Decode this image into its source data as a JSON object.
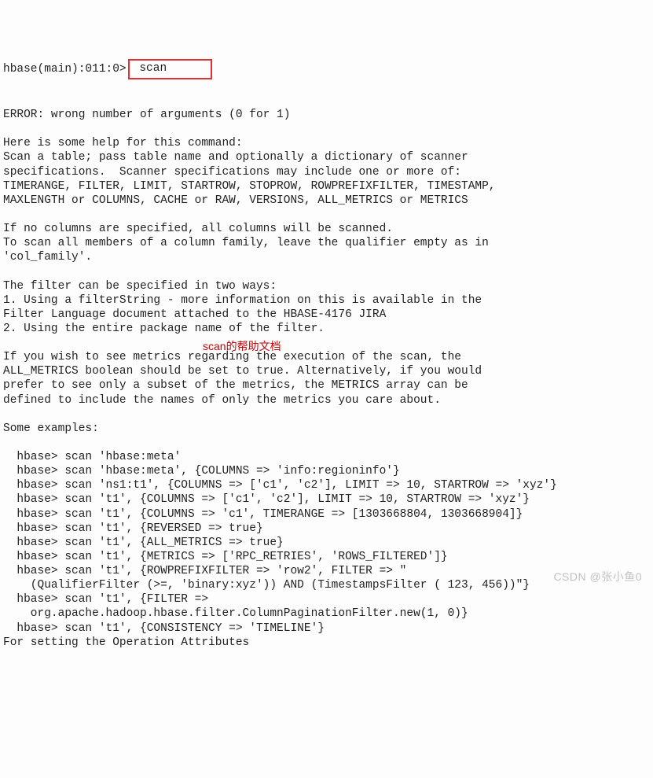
{
  "prompt": {
    "prefix": "hbase(main):011:0>",
    "command": " scan      "
  },
  "output": {
    "error": "ERROR: wrong number of arguments (0 for 1)",
    "help_intro": "Here is some help for this command:",
    "help_desc1": "Scan a table; pass table name and optionally a dictionary of scanner",
    "help_desc2": "specifications.  Scanner specifications may include one or more of:",
    "help_desc3": "TIMERANGE, FILTER, LIMIT, STARTROW, STOPROW, ROWPREFIXFILTER, TIMESTAMP,",
    "help_desc4": "MAXLENGTH or COLUMNS, CACHE or RAW, VERSIONS, ALL_METRICS or METRICS",
    "cols1": "If no columns are specified, all columns will be scanned.",
    "cols2": "To scan all members of a column family, leave the qualifier empty as in",
    "cols3": "'col_family'.",
    "filter1": "The filter can be specified in two ways:",
    "filter2": "1. Using a filterString - more information on this is available in the",
    "filter3": "Filter Language document attached to the HBASE-4176 JIRA",
    "filter4": "2. Using the entire package name of the filter.",
    "metrics1": "If you wish to see metrics regarding the execution of the scan, the",
    "metrics2": "ALL_METRICS boolean should be set to true. Alternatively, if you would",
    "metrics3": "prefer to see only a subset of the metrics, the METRICS array can be",
    "metrics4": "defined to include the names of only the metrics you care about.",
    "examples_label": "Some examples:",
    "ex1": "  hbase> scan 'hbase:meta'",
    "ex2": "  hbase> scan 'hbase:meta', {COLUMNS => 'info:regioninfo'}",
    "ex3": "  hbase> scan 'ns1:t1', {COLUMNS => ['c1', 'c2'], LIMIT => 10, STARTROW => 'xyz'}",
    "ex4": "  hbase> scan 't1', {COLUMNS => ['c1', 'c2'], LIMIT => 10, STARTROW => 'xyz'}",
    "ex5": "  hbase> scan 't1', {COLUMNS => 'c1', TIMERANGE => [1303668804, 1303668904]}",
    "ex6": "  hbase> scan 't1', {REVERSED => true}",
    "ex7": "  hbase> scan 't1', {ALL_METRICS => true}",
    "ex8": "  hbase> scan 't1', {METRICS => ['RPC_RETRIES', 'ROWS_FILTERED']}",
    "ex9": "  hbase> scan 't1', {ROWPREFIXFILTER => 'row2', FILTER => \"",
    "ex10": "    (QualifierFilter (>=, 'binary:xyz')) AND (TimestampsFilter ( 123, 456))\"}",
    "ex11": "  hbase> scan 't1', {FILTER =>",
    "ex12": "    org.apache.hadoop.hbase.filter.ColumnPaginationFilter.new(1, 0)}",
    "ex13": "  hbase> scan 't1', {CONSISTENCY => 'TIMELINE'}",
    "setting": "For setting the Operation Attributes"
  },
  "annotation": {
    "text": "scan的帮助文档"
  },
  "watermark": "CSDN @张小鱼0"
}
